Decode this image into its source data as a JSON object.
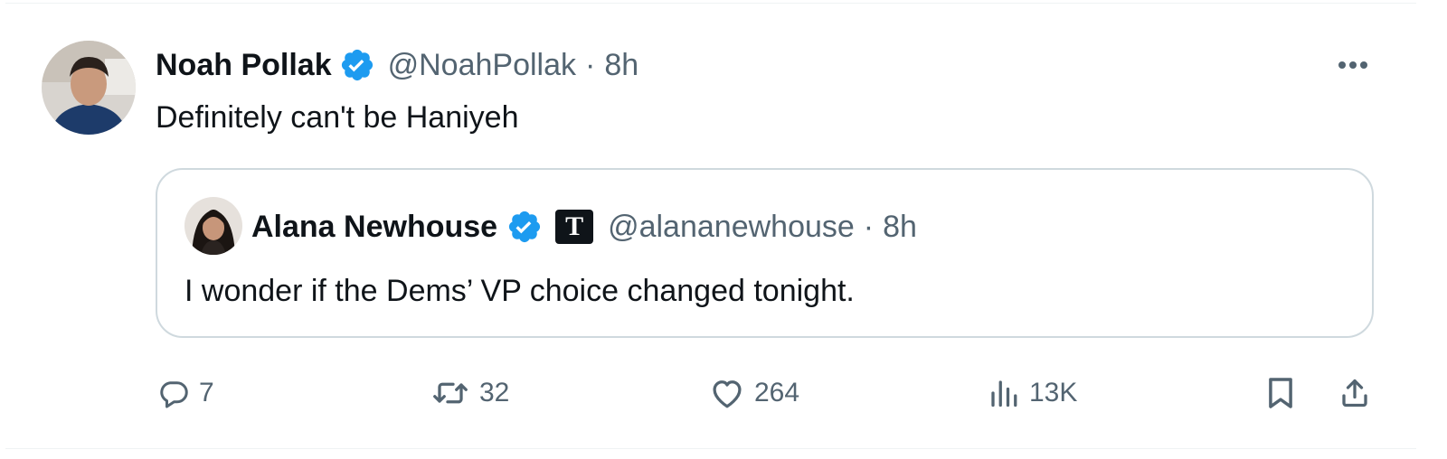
{
  "tweet": {
    "author_name": "Noah Pollak",
    "handle": "@NoahPollak",
    "separator": "·",
    "time": "8h",
    "text": "Definitely can't be Haniyeh"
  },
  "quoted_tweet": {
    "author_name": "Alana Newhouse",
    "affiliation_badge": "T",
    "handle": "@alananewhouse",
    "separator": "·",
    "time": "8h",
    "text": "I wonder if the Dems’ VP choice changed tonight."
  },
  "actions": {
    "replies": "7",
    "reposts": "32",
    "likes": "264",
    "views": "13K"
  },
  "icons": {
    "verified": "verified-badge-icon",
    "more": "more-options-icon",
    "reply": "reply-icon",
    "repost": "repost-icon",
    "like": "heart-icon",
    "views": "analytics-icon",
    "bookmark": "bookmark-icon",
    "share": "share-icon"
  },
  "colors": {
    "verified_blue": "#1d9bf0",
    "secondary_text": "#536471",
    "primary_text": "#0f1419",
    "border": "#cfd9de"
  }
}
